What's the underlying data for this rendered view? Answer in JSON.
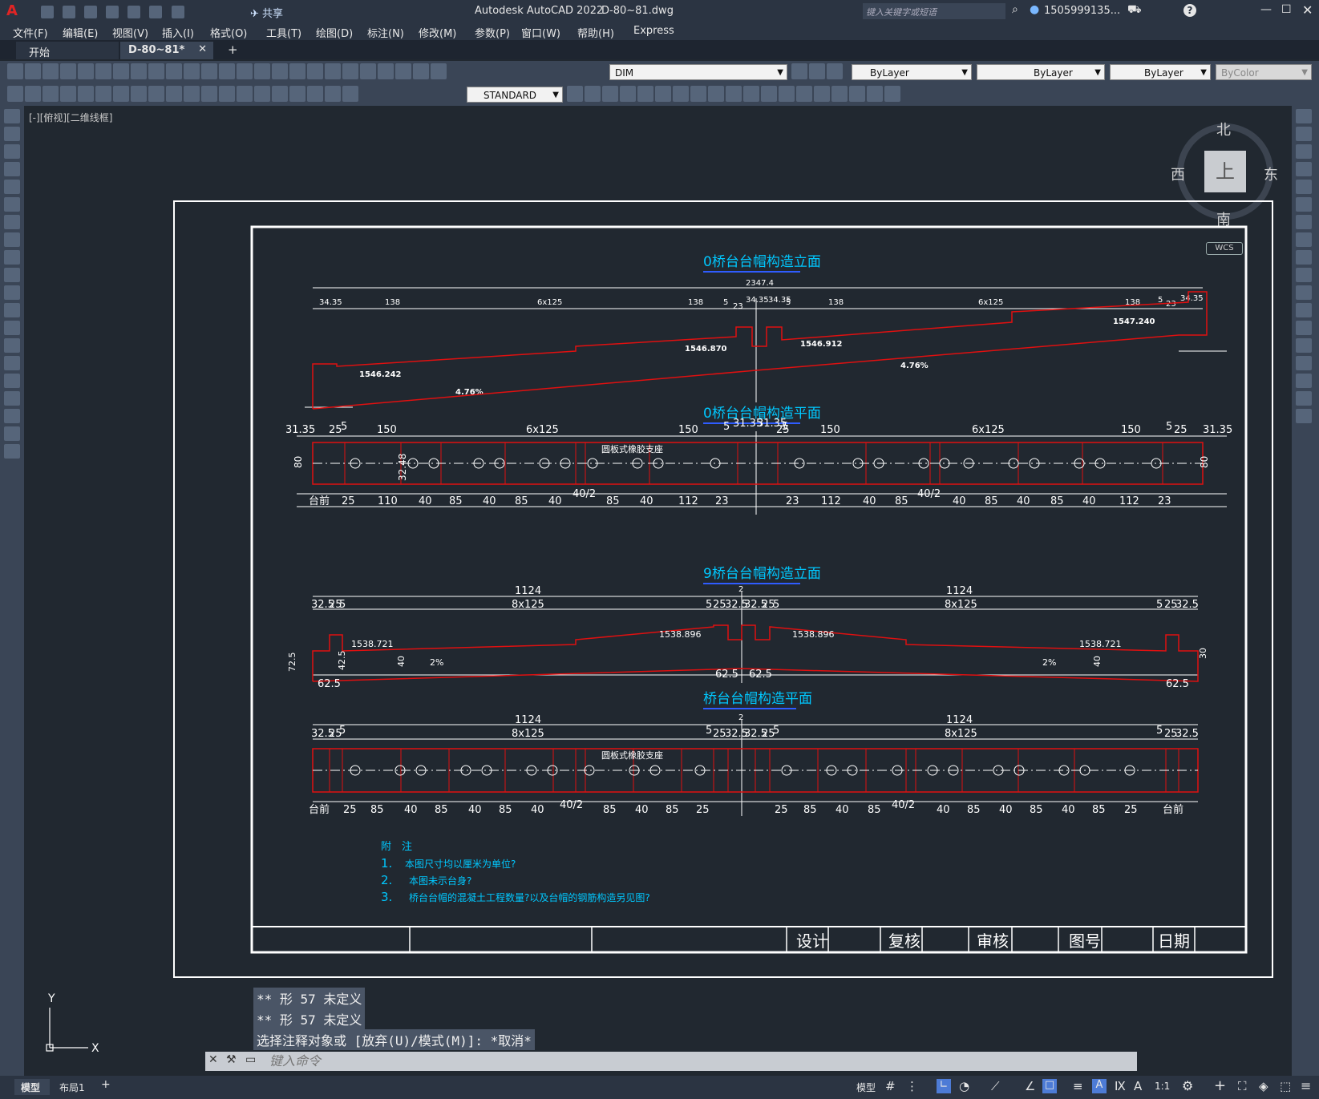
{
  "app": {
    "logo": "A",
    "title": "Autodesk AutoCAD 2022",
    "filename": "D-80~81.dwg",
    "share_label": "共享",
    "search_placeholder": "键入关键字或短语",
    "user": "1505999135...",
    "help": "?"
  },
  "menu": [
    "文件(F)",
    "编辑(E)",
    "视图(V)",
    "插入(I)",
    "格式(O)",
    "工具(T)",
    "绘图(D)",
    "标注(N)",
    "修改(M)",
    "参数(P)",
    "窗口(W)",
    "帮助(H)",
    "Express"
  ],
  "tabs": [
    {
      "label": "开始",
      "active": false
    },
    {
      "label": "D-80~81*",
      "active": true
    }
  ],
  "toolbar": {
    "layer": "DIM",
    "color": "ByLayer",
    "linetype": "ByLayer",
    "lineweight": "ByLayer",
    "plotstyle": "ByColor",
    "textstyle": "STANDARD"
  },
  "viewport_label": "[-][俯视][二维线框]",
  "viewcube": {
    "north": "北",
    "south": "南",
    "east": "东",
    "west": "西",
    "top": "上",
    "wcs": "WCS"
  },
  "drawing": {
    "title1": "0桥台台帽构造立面",
    "title2": "0桥台台帽构造平面",
    "title3": "9桥台台帽构造立面",
    "title4": "桥台台帽构造平面",
    "elev1_total": "2347.4",
    "elev1_dims_top": [
      "34.35",
      "138",
      "6x125",
      "138",
      "5",
      "23",
      "34.35",
      "34.35",
      "5",
      "138",
      "6x125",
      "138",
      "5",
      "23",
      "34.35"
    ],
    "elev1_levels": [
      "1546.242",
      "1546.870",
      "1546.912",
      "1547.240"
    ],
    "elev1_slope": [
      "4.76%",
      "4.76%"
    ],
    "plan1_top": [
      "31.35",
      "25",
      "5",
      "150",
      "6x125",
      "150",
      "5",
      "31.35",
      "31.35",
      "5",
      "25",
      "150",
      "6x125",
      "150",
      "5",
      "25",
      "31.35"
    ],
    "plan1_bottom_left": [
      "台前",
      "25",
      "110",
      "40",
      "85",
      "40",
      "85",
      "40",
      "40/2",
      "85",
      "40",
      "112",
      "23"
    ],
    "plan1_bottom_right": [
      "23",
      "112",
      "40",
      "85",
      "40/2",
      "40",
      "85",
      "40",
      "85",
      "40",
      "112",
      "23"
    ],
    "plan1_support": "圆板式橡胶支座",
    "plan1_side": [
      "80",
      "32.48",
      "80"
    ],
    "elev2_top": [
      "1124",
      "2",
      "1124"
    ],
    "elev2_second": [
      "32.5",
      "25",
      "5",
      "8x125",
      "5",
      "25",
      "32.5",
      "32.5",
      "25",
      "5",
      "8x125",
      "5",
      "25",
      "32.5"
    ],
    "elev2_levels": [
      "1538.721",
      "1538.896",
      "1538.896",
      "1538.721"
    ],
    "elev2_slope": [
      "2%",
      "2%"
    ],
    "elev2_dims": [
      "62.5",
      "62.5",
      "62.5",
      "62.5",
      "40",
      "40",
      "72.5",
      "42.5",
      "30"
    ],
    "plan2_top": [
      "1124",
      "2",
      "1124"
    ],
    "plan2_second": [
      "32.5",
      "25",
      "5",
      "8x125",
      "5",
      "25",
      "32.5",
      "32.5",
      "25",
      "5",
      "8x125",
      "5",
      "25",
      "32.5"
    ],
    "plan2_bottom": [
      "台前",
      "25",
      "85",
      "40",
      "85",
      "40",
      "85",
      "40",
      "40/2",
      "85",
      "40",
      "85",
      "25",
      "25",
      "85",
      "40",
      "85",
      "40/2",
      "40",
      "85",
      "40",
      "85",
      "40",
      "85",
      "25",
      "台前"
    ],
    "plan2_support": "圆板式橡胶支座",
    "notes_title": "附　注",
    "notes": [
      {
        "num": "1.",
        "text": "本图尺寸均以厘米为单位?"
      },
      {
        "num": "2.",
        "text": "本图未示台身?"
      },
      {
        "num": "3.",
        "text": "桥台台帽的混凝土工程数量?以及台帽的钢筋构造另见图?"
      }
    ],
    "titleblock": [
      "设计",
      "复核",
      "审核",
      "图号",
      "日期"
    ]
  },
  "command": {
    "history": [
      "** 形 57 未定义",
      "** 形 57 未定义",
      "选择注释对象或 [放弃(U)/模式(M)]: *取消*"
    ],
    "placeholder": "键入命令"
  },
  "ucs": {
    "x": "X",
    "y": "Y"
  },
  "layout_tabs": [
    "模型",
    "布局1"
  ],
  "status": {
    "model": "模型",
    "scale": "1:1"
  },
  "colors": {
    "drawing_bg": "#212830",
    "red": "#e01010",
    "cyan": "#00c8ff",
    "white": "#ffffff"
  }
}
